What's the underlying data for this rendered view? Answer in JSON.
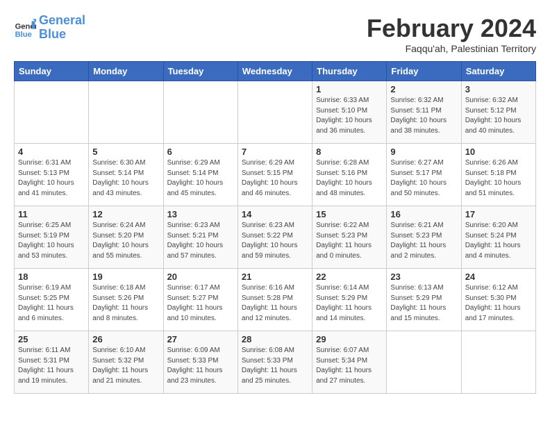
{
  "header": {
    "logo_line1": "General",
    "logo_line2": "Blue",
    "month_title": "February 2024",
    "subtitle": "Faqqu'ah, Palestinian Territory"
  },
  "days_of_week": [
    "Sunday",
    "Monday",
    "Tuesday",
    "Wednesday",
    "Thursday",
    "Friday",
    "Saturday"
  ],
  "weeks": [
    [
      {
        "num": "",
        "info": ""
      },
      {
        "num": "",
        "info": ""
      },
      {
        "num": "",
        "info": ""
      },
      {
        "num": "",
        "info": ""
      },
      {
        "num": "1",
        "info": "Sunrise: 6:33 AM\nSunset: 5:10 PM\nDaylight: 10 hours\nand 36 minutes."
      },
      {
        "num": "2",
        "info": "Sunrise: 6:32 AM\nSunset: 5:11 PM\nDaylight: 10 hours\nand 38 minutes."
      },
      {
        "num": "3",
        "info": "Sunrise: 6:32 AM\nSunset: 5:12 PM\nDaylight: 10 hours\nand 40 minutes."
      }
    ],
    [
      {
        "num": "4",
        "info": "Sunrise: 6:31 AM\nSunset: 5:13 PM\nDaylight: 10 hours\nand 41 minutes."
      },
      {
        "num": "5",
        "info": "Sunrise: 6:30 AM\nSunset: 5:14 PM\nDaylight: 10 hours\nand 43 minutes."
      },
      {
        "num": "6",
        "info": "Sunrise: 6:29 AM\nSunset: 5:14 PM\nDaylight: 10 hours\nand 45 minutes."
      },
      {
        "num": "7",
        "info": "Sunrise: 6:29 AM\nSunset: 5:15 PM\nDaylight: 10 hours\nand 46 minutes."
      },
      {
        "num": "8",
        "info": "Sunrise: 6:28 AM\nSunset: 5:16 PM\nDaylight: 10 hours\nand 48 minutes."
      },
      {
        "num": "9",
        "info": "Sunrise: 6:27 AM\nSunset: 5:17 PM\nDaylight: 10 hours\nand 50 minutes."
      },
      {
        "num": "10",
        "info": "Sunrise: 6:26 AM\nSunset: 5:18 PM\nDaylight: 10 hours\nand 51 minutes."
      }
    ],
    [
      {
        "num": "11",
        "info": "Sunrise: 6:25 AM\nSunset: 5:19 PM\nDaylight: 10 hours\nand 53 minutes."
      },
      {
        "num": "12",
        "info": "Sunrise: 6:24 AM\nSunset: 5:20 PM\nDaylight: 10 hours\nand 55 minutes."
      },
      {
        "num": "13",
        "info": "Sunrise: 6:23 AM\nSunset: 5:21 PM\nDaylight: 10 hours\nand 57 minutes."
      },
      {
        "num": "14",
        "info": "Sunrise: 6:23 AM\nSunset: 5:22 PM\nDaylight: 10 hours\nand 59 minutes."
      },
      {
        "num": "15",
        "info": "Sunrise: 6:22 AM\nSunset: 5:23 PM\nDaylight: 11 hours\nand 0 minutes."
      },
      {
        "num": "16",
        "info": "Sunrise: 6:21 AM\nSunset: 5:23 PM\nDaylight: 11 hours\nand 2 minutes."
      },
      {
        "num": "17",
        "info": "Sunrise: 6:20 AM\nSunset: 5:24 PM\nDaylight: 11 hours\nand 4 minutes."
      }
    ],
    [
      {
        "num": "18",
        "info": "Sunrise: 6:19 AM\nSunset: 5:25 PM\nDaylight: 11 hours\nand 6 minutes."
      },
      {
        "num": "19",
        "info": "Sunrise: 6:18 AM\nSunset: 5:26 PM\nDaylight: 11 hours\nand 8 minutes."
      },
      {
        "num": "20",
        "info": "Sunrise: 6:17 AM\nSunset: 5:27 PM\nDaylight: 11 hours\nand 10 minutes."
      },
      {
        "num": "21",
        "info": "Sunrise: 6:16 AM\nSunset: 5:28 PM\nDaylight: 11 hours\nand 12 minutes."
      },
      {
        "num": "22",
        "info": "Sunrise: 6:14 AM\nSunset: 5:29 PM\nDaylight: 11 hours\nand 14 minutes."
      },
      {
        "num": "23",
        "info": "Sunrise: 6:13 AM\nSunset: 5:29 PM\nDaylight: 11 hours\nand 15 minutes."
      },
      {
        "num": "24",
        "info": "Sunrise: 6:12 AM\nSunset: 5:30 PM\nDaylight: 11 hours\nand 17 minutes."
      }
    ],
    [
      {
        "num": "25",
        "info": "Sunrise: 6:11 AM\nSunset: 5:31 PM\nDaylight: 11 hours\nand 19 minutes."
      },
      {
        "num": "26",
        "info": "Sunrise: 6:10 AM\nSunset: 5:32 PM\nDaylight: 11 hours\nand 21 minutes."
      },
      {
        "num": "27",
        "info": "Sunrise: 6:09 AM\nSunset: 5:33 PM\nDaylight: 11 hours\nand 23 minutes."
      },
      {
        "num": "28",
        "info": "Sunrise: 6:08 AM\nSunset: 5:33 PM\nDaylight: 11 hours\nand 25 minutes."
      },
      {
        "num": "29",
        "info": "Sunrise: 6:07 AM\nSunset: 5:34 PM\nDaylight: 11 hours\nand 27 minutes."
      },
      {
        "num": "",
        "info": ""
      },
      {
        "num": "",
        "info": ""
      }
    ]
  ]
}
